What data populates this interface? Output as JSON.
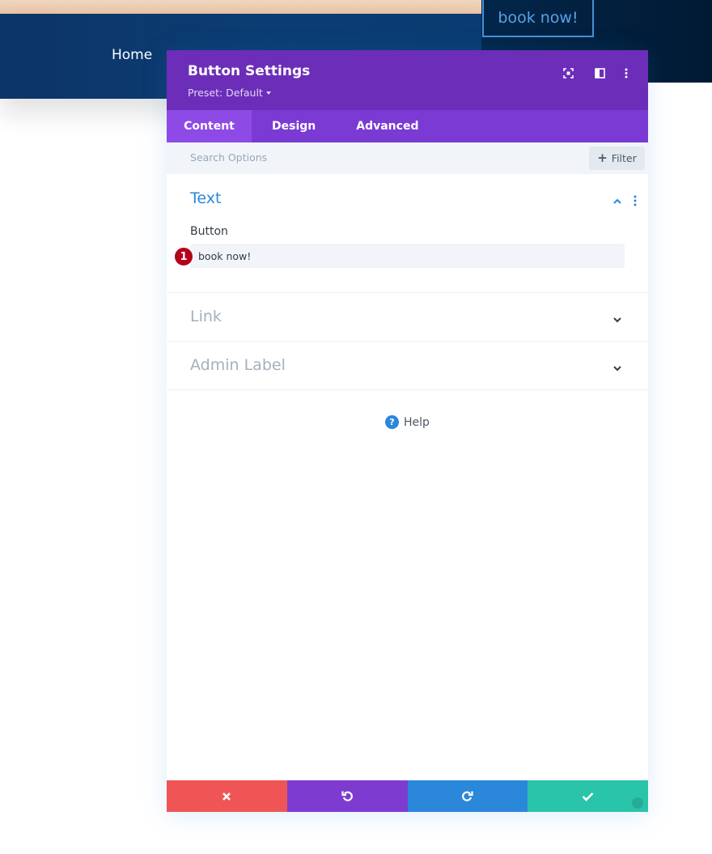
{
  "site": {
    "nav_home": "Home",
    "book_button": "book now!"
  },
  "modal": {
    "title": "Button Settings",
    "preset": "Preset: Default",
    "header_icons": [
      "focus-icon",
      "split-view-icon",
      "more-vertical-icon"
    ],
    "tabs": [
      {
        "label": "Content",
        "active": true
      },
      {
        "label": "Design",
        "active": false
      },
      {
        "label": "Advanced",
        "active": false
      }
    ],
    "search": {
      "placeholder": "Search Options",
      "filter_label": "Filter"
    },
    "sections": {
      "text": {
        "title": "Text",
        "expanded": true,
        "field_label": "Button",
        "field_value": "book now!",
        "marker": "1"
      },
      "link": {
        "title": "Link",
        "expanded": false
      },
      "admin_label": {
        "title": "Admin Label",
        "expanded": false
      }
    },
    "help_label": "Help",
    "footer_buttons": [
      "cancel-icon",
      "undo-icon",
      "redo-icon",
      "save-check-icon"
    ]
  },
  "colors": {
    "header_purple": "#6c2eb9",
    "tab_purple": "#7b3ad3",
    "tab_active": "#8e4ae6",
    "accent_blue": "#2b87da",
    "cancel_red": "#ef5555",
    "undo_purple": "#7e3bd0",
    "redo_blue": "#2b87da",
    "save_teal": "#29c4a9",
    "marker_red": "#b5001d",
    "nav_navy": "#0b3d74"
  }
}
